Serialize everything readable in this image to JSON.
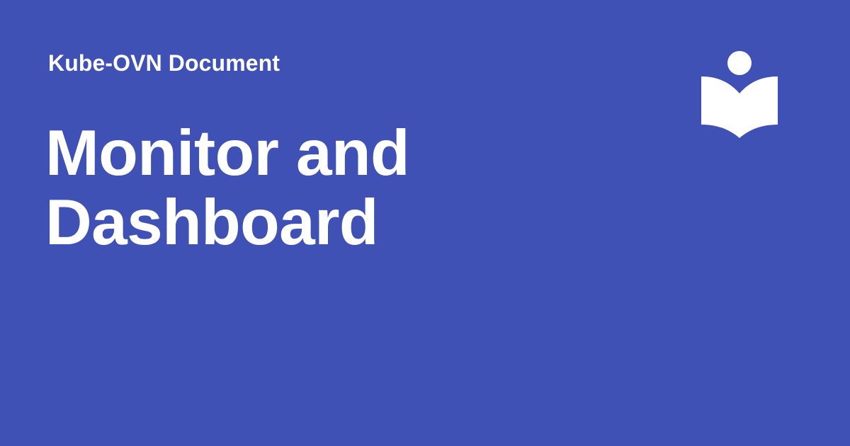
{
  "site": {
    "name": "Kube-OVN Document"
  },
  "page": {
    "title": "Monitor and Dashboard"
  },
  "logo": {
    "icon": "open-book-reader-icon",
    "color": "#ffffff"
  },
  "theme": {
    "background": "#4051b5",
    "text": "#ffffff"
  }
}
